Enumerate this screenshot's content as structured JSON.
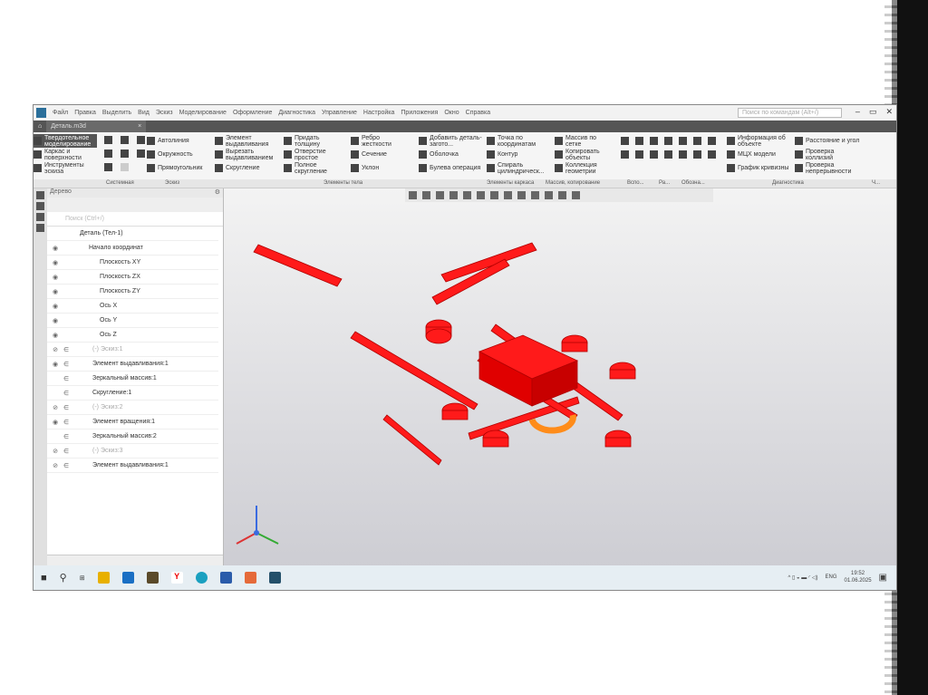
{
  "window": {
    "menu": [
      "Файл",
      "Правка",
      "Выделить",
      "Вид",
      "Эскиз",
      "Моделирование",
      "Оформление",
      "Диагностика",
      "Управление",
      "Настройка",
      "Приложения",
      "Окно",
      "Справка"
    ],
    "search_placeholder": "Поиск по командам (Alt+/)",
    "tab": "Деталь.m3d"
  },
  "ribbon": {
    "modes": [
      "Твердотельное моделирование",
      "Каркас и поверхности",
      "Инструменты эскиза"
    ],
    "sketch": [
      "Автолиния",
      "Окружность",
      "Прямоугольник"
    ],
    "body1": [
      "Элемент выдавливания",
      "Вырезать выдавливанием",
      "Скругление"
    ],
    "body2": [
      "Придать толщину",
      "Отверстие простое",
      "Полное скругление"
    ],
    "body3": [
      "Ребро жесткости",
      "Сечение",
      "Уклон"
    ],
    "body4": [
      "Добавить деталь-загото...",
      "Оболочка",
      "Булева операция"
    ],
    "frame": [
      "Точка по координатам",
      "Контур",
      "Спираль цилиндрическ..."
    ],
    "array": [
      "Массив по сетке",
      "Копировать объекты",
      "Коллекция геометрии"
    ],
    "diag1": [
      "Информация об объекте",
      "МЦХ модели",
      "График кривизны"
    ],
    "diag2": [
      "Расстояние и угол",
      "Проверка коллизий",
      "Проверка непрерывности"
    ],
    "groups": [
      "Системная",
      "Эскиз",
      "Элементы тела",
      "Элементы каркаса",
      "Массив, копирование",
      "Вспо...",
      "Ра...",
      "Обозна...",
      "Диагностика",
      "Ч..."
    ]
  },
  "tree": {
    "title": "Дерево",
    "search_placeholder": "Поиск (Ctrl+/)",
    "items": [
      {
        "label": "Деталь (Тел-1)",
        "dim": false
      },
      {
        "label": "Начало координат",
        "dim": false
      },
      {
        "label": "Плоскость XY",
        "dim": false
      },
      {
        "label": "Плоскость ZX",
        "dim": false
      },
      {
        "label": "Плоскость ZY",
        "dim": false
      },
      {
        "label": "Ось X",
        "dim": false
      },
      {
        "label": "Ось Y",
        "dim": false
      },
      {
        "label": "Ось Z",
        "dim": false
      },
      {
        "label": "(-) Эскиз:1",
        "dim": true
      },
      {
        "label": "Элемент выдавливания:1",
        "dim": false
      },
      {
        "label": "Зеркальный массив:1",
        "dim": false
      },
      {
        "label": "Скругление:1",
        "dim": false
      },
      {
        "label": "(-) Эскиз:2",
        "dim": true
      },
      {
        "label": "Элемент вращения:1",
        "dim": false
      },
      {
        "label": "Зеркальный массив:2",
        "dim": false
      },
      {
        "label": "(-) Эскиз:3",
        "dim": true
      },
      {
        "label": "Элемент выдавливания:1",
        "dim": false
      }
    ]
  },
  "taskbar": {
    "lang": "ENG",
    "time": "19:52",
    "date": "01.06.2025"
  },
  "colors": {
    "model": "#ff1a1a",
    "accent": "#ff8c1a"
  }
}
